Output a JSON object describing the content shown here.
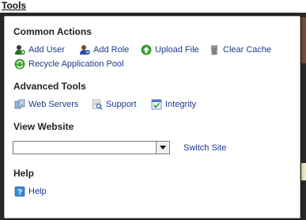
{
  "menu": {
    "label": "Tools"
  },
  "common_actions": {
    "title": "Common Actions",
    "items": [
      {
        "label": "Add User",
        "icon": "add-user-icon"
      },
      {
        "label": "Add Role",
        "icon": "add-role-icon"
      },
      {
        "label": "Upload File",
        "icon": "upload-icon"
      },
      {
        "label": "Clear Cache",
        "icon": "trash-icon"
      },
      {
        "label": "Recycle Application Pool",
        "icon": "recycle-icon"
      }
    ]
  },
  "advanced_tools": {
    "title": "Advanced Tools",
    "items": [
      {
        "label": "Web Servers",
        "icon": "servers-icon"
      },
      {
        "label": "Support",
        "icon": "support-icon"
      },
      {
        "label": "Integrity",
        "icon": "integrity-icon"
      }
    ]
  },
  "view_website": {
    "title": "View Website",
    "select_value": "",
    "switch_label": "Switch Site"
  },
  "help": {
    "title": "Help",
    "items": [
      {
        "label": "Help",
        "icon": "help-icon"
      }
    ]
  },
  "colors": {
    "link": "#1a3a8a",
    "heading": "#222222"
  }
}
